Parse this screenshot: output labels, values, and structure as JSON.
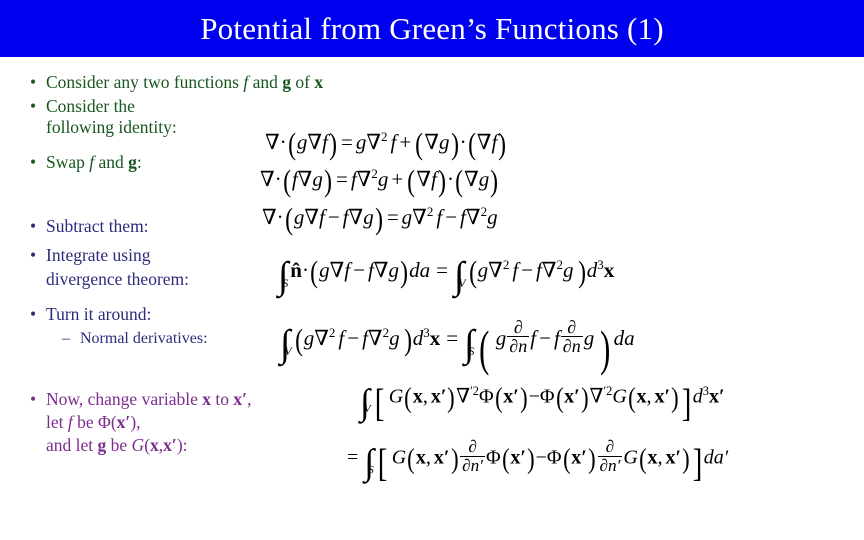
{
  "slide": {
    "title": "Potential from Green’s Functions (1)",
    "banner_color": "#0000f0",
    "title_color": "#ffffff",
    "background_color": "#ffffff"
  },
  "colors": {
    "green": "#18571f",
    "navy": "#2c2c7c",
    "purple": "#7b2d8e",
    "math": "#000000"
  },
  "bullets": {
    "b1": {
      "marker": "•",
      "text_a": "Consider any two functions ",
      "var_f": "f",
      "text_b": " and ",
      "var_g": "g",
      "text_c": " of ",
      "var_x": "x",
      "color": "green"
    },
    "b2": {
      "marker": "•",
      "line1": "Consider the",
      "line2": "following identity:",
      "color": "green"
    },
    "b3": {
      "marker": "•",
      "text_a": "Swap ",
      "var_f": "f",
      "text_b": " and ",
      "var_g": "g",
      "text_c": ":",
      "color": "green"
    },
    "b4": {
      "marker": "•",
      "text": "Subtract them:",
      "color": "navy"
    },
    "b5": {
      "marker": "•",
      "line1": "Integrate using",
      "line2": "divergence theorem:",
      "color": "navy"
    },
    "b6": {
      "marker": "•",
      "text": "Turn it around:",
      "color": "navy"
    },
    "b6sub": {
      "marker": "–",
      "text": "Normal derivatives:",
      "color": "navy"
    },
    "b7": {
      "marker": "•",
      "line1_a": "Now, change variable ",
      "line1_x": "x",
      "line1_b": " to ",
      "line1_xp": "x′",
      "line1_c": ",",
      "line2_a": "let ",
      "line2_f": "f",
      "line2_b": " be ",
      "line2_phi": "Φ(",
      "line2_xp": "x′",
      "line2_c": "),",
      "line3_a": "and let ",
      "line3_g": "g",
      "line3_b": " be ",
      "line3_G": "G",
      "line3_c": "(",
      "line3_x": "x",
      "line3_d": ",",
      "line3_xp": "x′",
      "line3_e": "):",
      "color": "purple"
    }
  },
  "equations": {
    "eq1": {
      "name": "green-identity-gf",
      "latex": "\\nabla\\cdot(g\\nabla f) = g\\nabla^2 f + (\\nabla g)\\cdot(\\nabla f)",
      "plain": "∇·(g∇f) = g∇²f + (∇g)·(∇f)"
    },
    "eq2": {
      "name": "green-identity-fg",
      "latex": "\\nabla\\cdot(f\\nabla g) = f\\nabla^2 g + (\\nabla f)\\cdot(\\nabla g)",
      "plain": "∇·(f∇g) = f∇²g + (∇f)·(∇g)"
    },
    "eq3": {
      "name": "green-identity-subtracted",
      "latex": "\\nabla\\cdot(g\\nabla f - f\\nabla g) = g\\nabla^2 f - f\\nabla^2 g",
      "plain": "∇·(g∇f − f∇g) = g∇²f − f∇²g"
    },
    "eq4": {
      "name": "divergence-theorem-form",
      "latex": "\\int_S \\hat{\\mathbf{n}}\\cdot(g\\nabla f - f\\nabla g)\\,da = \\int_V (g\\nabla^2 f - f\\nabla^2 g)\\,d^3\\mathbf{x}",
      "plain": "∫_S n̂·(g∇f − f∇g)da = ∫_V (g∇²f − f∇²g)d³x"
    },
    "eq5": {
      "name": "turned-around-normal-derivatives",
      "latex": "\\int_V (g\\nabla^2 f - f\\nabla^2 g)\\,d^3\\mathbf{x} = \\int_S \\left( g\\frac{\\partial}{\\partial n}f - f\\frac{\\partial}{\\partial n}g \\right) da",
      "plain": "∫_V (g∇²f − f∇²g)d³x = ∫_S ( g ∂/∂n f − f ∂/∂n g ) da"
    },
    "eq6": {
      "name": "greens-function-volume-integral",
      "latex": "\\int_V \\left[ G(\\mathbf{x},\\mathbf{x}')\\nabla'^2\\Phi(\\mathbf{x}') - \\Phi(\\mathbf{x}')\\nabla'^2 G(\\mathbf{x},\\mathbf{x}') \\right] d^3\\mathbf{x}'",
      "plain": "∫_V [ G(x,x′)∇′²Φ(x′) − Φ(x′)∇′²G(x,x′) ] d³x′"
    },
    "eq7": {
      "name": "greens-function-surface-integral",
      "latex": "= \\int_S \\left[ G(\\mathbf{x},\\mathbf{x}')\\frac{\\partial}{\\partial n'}\\Phi(\\mathbf{x}') - \\Phi(\\mathbf{x}')\\frac{\\partial}{\\partial n'}G(\\mathbf{x},\\mathbf{x}') \\right] da'",
      "plain": "= ∫_S [ G(x,x′) ∂/∂n′ Φ(x′) − Φ(x′) ∂/∂n′ G(x,x′) ] da′"
    }
  },
  "symbols": {
    "nabla": "∇",
    "dot": "·",
    "minus": "−",
    "plus": "+",
    "equals": "=",
    "partial": "∂",
    "integral": "∫",
    "phi": "Φ",
    "prime": "′",
    "nhat": "n̂"
  }
}
